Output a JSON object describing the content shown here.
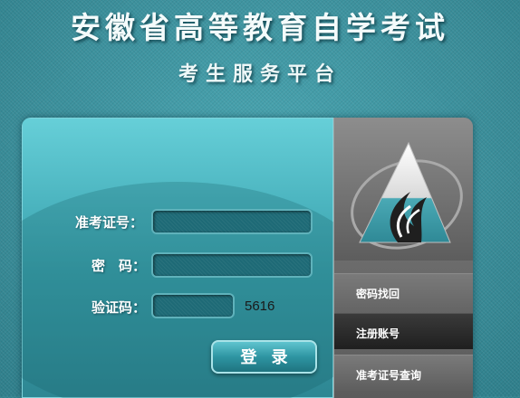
{
  "header": {
    "title": "安徽省高等教育自学考试",
    "subtitle": "考生服务平台"
  },
  "login_form": {
    "exam_id_label": "准考证号：",
    "password_label": "密　码：",
    "captcha_label": "验证码：",
    "exam_id_value": "",
    "password_value": "",
    "captcha_value": "",
    "captcha_code": "5616",
    "login_button": "登录"
  },
  "side_menu": {
    "items": [
      {
        "label": "密码找回"
      },
      {
        "label": "注册账号"
      },
      {
        "label": "准考证号查询"
      }
    ]
  },
  "colors": {
    "background": "#3e93a0",
    "panel_teal": "#4cb5c0",
    "side_gray": "#6a6a6a",
    "active_item": "#262626"
  },
  "icons": {
    "logo": "triangle-flame-logo-icon"
  }
}
